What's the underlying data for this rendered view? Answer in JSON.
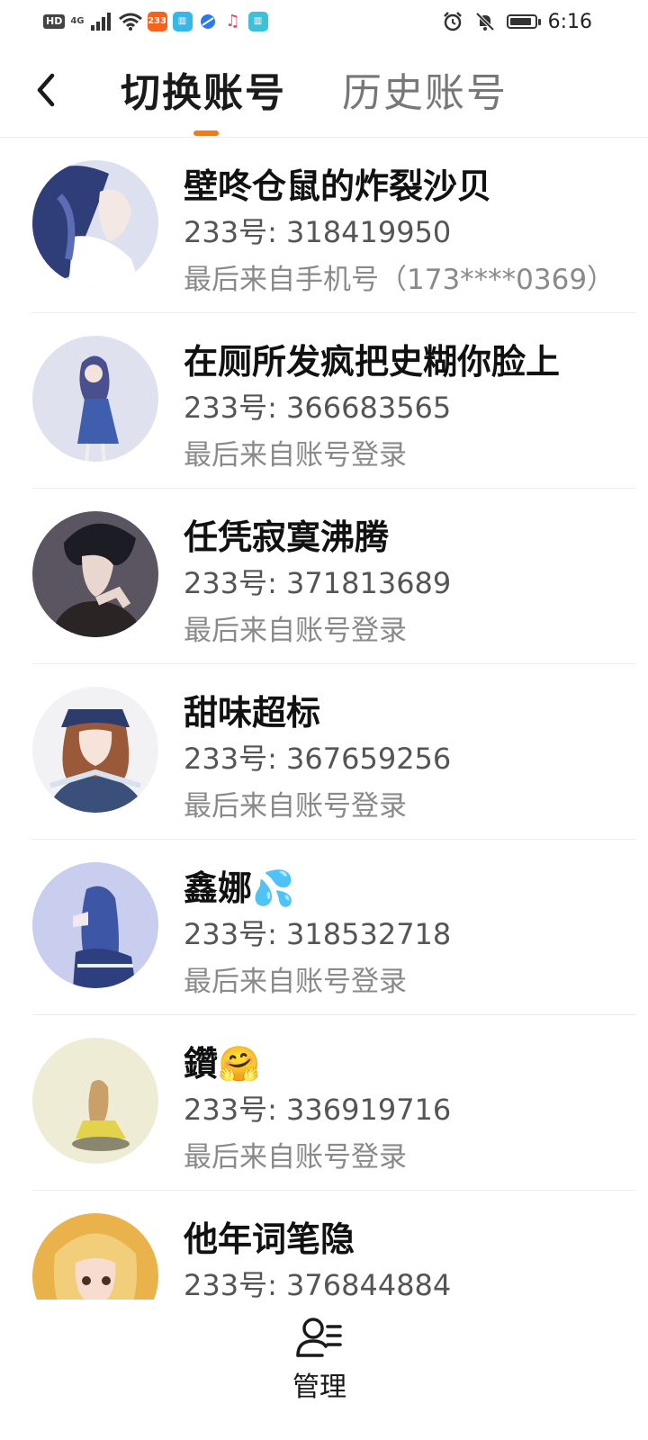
{
  "status_bar": {
    "network": "4G",
    "badge_233": "233",
    "time": "6:16",
    "battery_level": 0.9
  },
  "header": {
    "tab_switch": "切换账号",
    "tab_history": "历史账号"
  },
  "accounts": [
    {
      "name": "壁咚仓鼠的炸裂沙贝",
      "id": "233号: 318419950",
      "login": "最后来自手机号（173****0369）"
    },
    {
      "name": "在厕所发疯把史糊你脸上",
      "id": "233号: 366683565",
      "login": "最后来自账号登录"
    },
    {
      "name": "任凭寂寞沸腾",
      "id": "233号: 371813689",
      "login": "最后来自账号登录"
    },
    {
      "name": "甜味超标",
      "id": "233号: 367659256",
      "login": "最后来自账号登录"
    },
    {
      "name": "鑫娜💦",
      "id": "233号: 318532718",
      "login": "最后来自账号登录"
    },
    {
      "name": "鑽🤗",
      "id": "233号: 336919716",
      "login": "最后来自账号登录"
    },
    {
      "name": "他年词笔隐",
      "id": "233号: 376844884",
      "login": ""
    }
  ],
  "bottom_bar": {
    "manage_label": "管理"
  },
  "colors": {
    "accent": "#f27a1d"
  }
}
